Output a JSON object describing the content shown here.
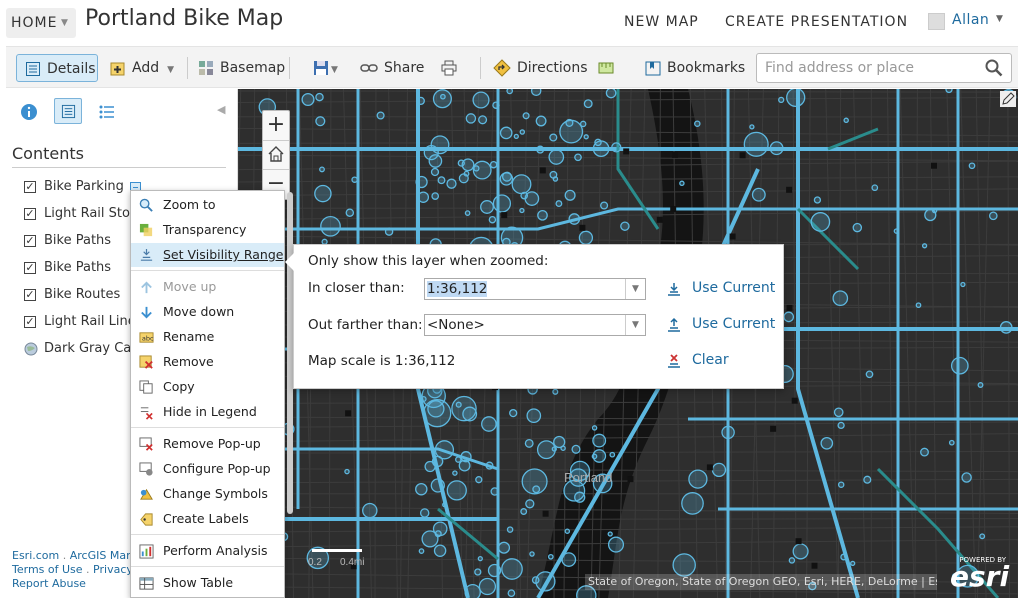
{
  "topbar": {
    "home_label": "HOME",
    "map_title": "Portland Bike Map",
    "new_map": "NEW MAP",
    "create_presentation": "CREATE PRESENTATION",
    "user_name": "Allan"
  },
  "toolbar": {
    "details": "Details",
    "add": "Add",
    "basemap": "Basemap",
    "share": "Share",
    "directions": "Directions",
    "bookmarks": "Bookmarks",
    "search_placeholder": "Find address or place"
  },
  "sidebar": {
    "heading": "Contents",
    "layers": [
      {
        "label": "Bike Parking",
        "checked": true
      },
      {
        "label": "Light Rail Stop",
        "checked": true
      },
      {
        "label": "Bike Paths",
        "checked": true
      },
      {
        "label": "Bike Paths",
        "checked": true
      },
      {
        "label": "Bike Routes",
        "checked": true
      },
      {
        "label": "Light Rail Line",
        "checked": true
      },
      {
        "label": "Dark Gray Can",
        "checked": false
      }
    ],
    "footer": {
      "esri": "Esri.com",
      "arcgis": "ArcGIS Mark",
      "terms": "Terms of Use",
      "privacy": "Privacy",
      "report": "Report Abuse"
    }
  },
  "context_menu": {
    "items": [
      {
        "label": "Zoom to",
        "icon": "zoom-to-icon"
      },
      {
        "label": "Transparency",
        "icon": "transparency-icon"
      },
      {
        "label": "Set Visibility Range",
        "icon": "visibility-range-icon",
        "selected": true
      },
      {
        "label": "Move up",
        "icon": "arrow-up-icon",
        "disabled": true
      },
      {
        "label": "Move down",
        "icon": "arrow-down-icon"
      },
      {
        "label": "Rename",
        "icon": "rename-icon"
      },
      {
        "label": "Remove",
        "icon": "remove-icon"
      },
      {
        "label": "Copy",
        "icon": "copy-icon"
      },
      {
        "label": "Hide in Legend",
        "icon": "hide-legend-icon"
      },
      {
        "label": "Remove Pop-up",
        "icon": "remove-popup-icon"
      },
      {
        "label": "Configure Pop-up",
        "icon": "configure-popup-icon"
      },
      {
        "label": "Change Symbols",
        "icon": "change-symbols-icon"
      },
      {
        "label": "Create Labels",
        "icon": "create-labels-icon"
      },
      {
        "label": "Perform Analysis",
        "icon": "analysis-icon"
      },
      {
        "label": "Show Table",
        "icon": "table-icon"
      }
    ]
  },
  "visibility_popup": {
    "heading": "Only show this layer when zoomed:",
    "closer_label": "In closer than:",
    "closer_value": "1:36,112",
    "farther_label": "Out farther than:",
    "farther_value": "<None>",
    "use_current": "Use Current",
    "use_current_2": "Use Current",
    "map_scale": "Map scale is 1:36,112",
    "clear": "Clear"
  },
  "map": {
    "city_label": "Portland",
    "attribution": "State of Oregon, State of Oregon GEO, Esri, HERE, DeLorme | Esri,...",
    "scale_text_1": "0.2",
    "scale_text_2": "0.4mi",
    "powered_by": "POWERED BY",
    "esri_logo": "esri",
    "colors": {
      "background": "#2e2e2e",
      "water": "#141414",
      "path": "#5db8e0",
      "route": "#2a8c8c",
      "accent": "#1e6a9e"
    }
  }
}
